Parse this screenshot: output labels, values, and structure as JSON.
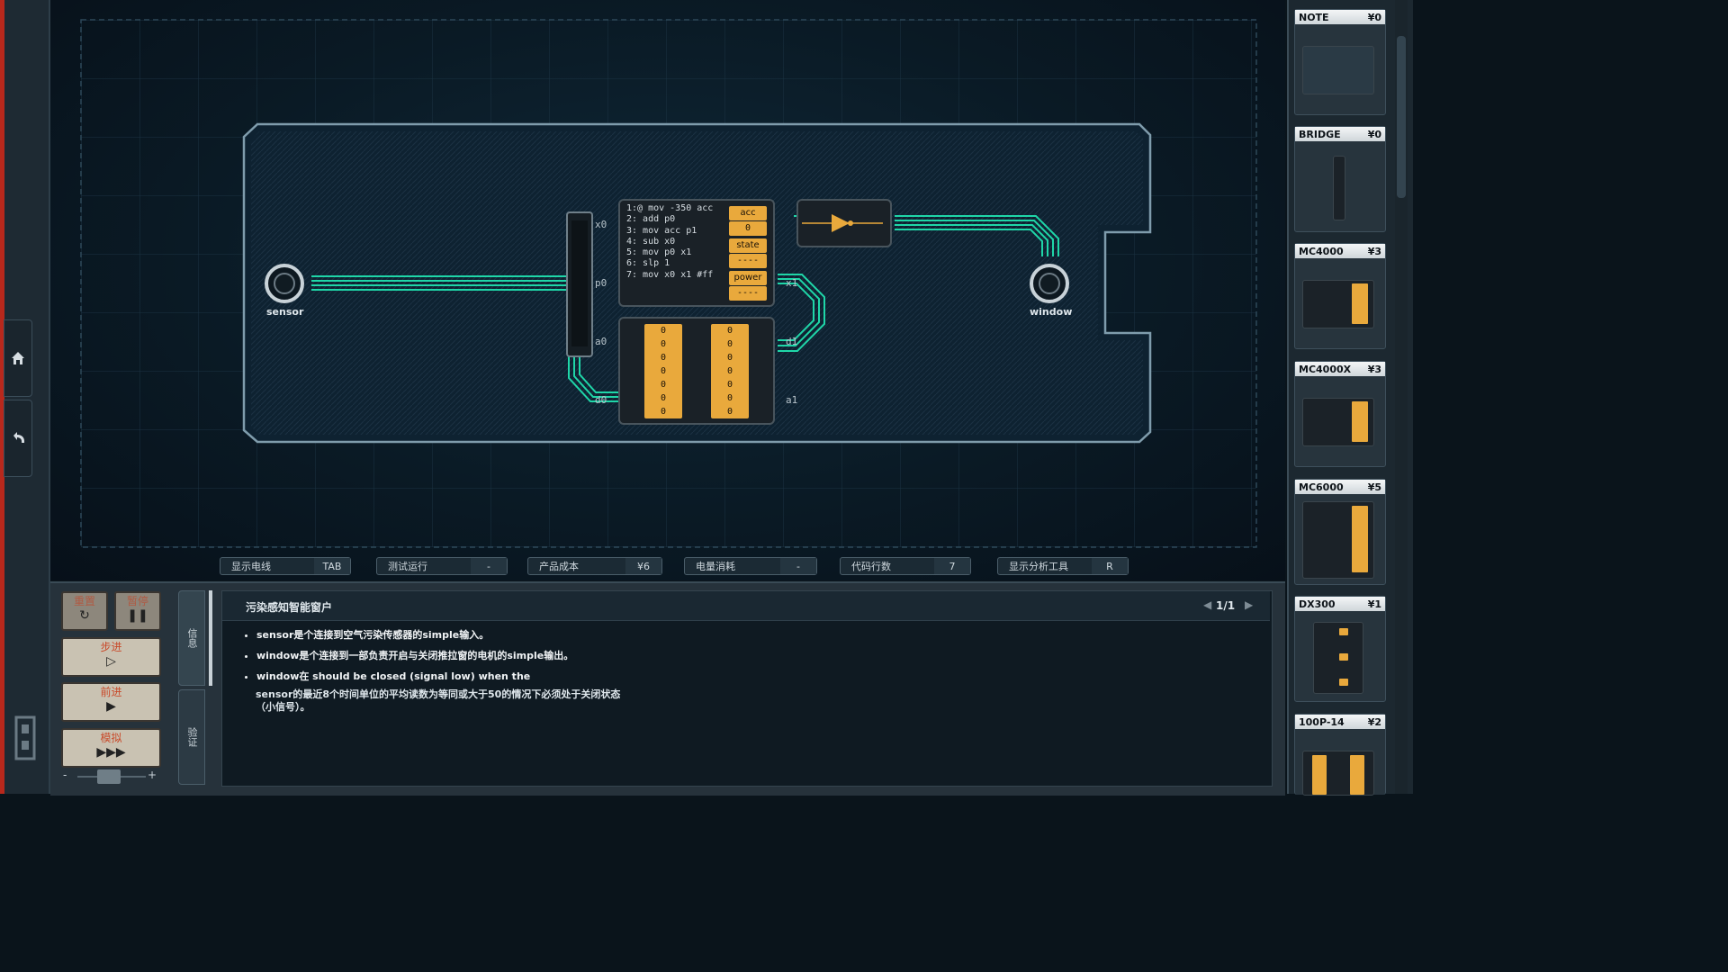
{
  "board": {
    "sensor_label": "sensor",
    "window_label": "window",
    "mc6000": {
      "code": [
        "1:@ mov -350 acc",
        "2:  add p0",
        "3:  mov acc p1",
        "4:  sub x0",
        "5:  mov p0 x1",
        "6:  slp 1",
        "7:  mov x0 x1 #ff"
      ],
      "registers": [
        {
          "name": "acc",
          "value": "0"
        },
        {
          "name": "state",
          "value": "----"
        },
        {
          "name": "power",
          "value": "----"
        }
      ],
      "ports": {
        "x0": "x0",
        "p0": "p0",
        "x1": "x1"
      }
    },
    "ram": {
      "col_a": [
        "0",
        "0",
        "0",
        "0",
        "0",
        "0",
        "0"
      ],
      "col_b": [
        "0",
        "0",
        "0",
        "0",
        "0",
        "0",
        "0"
      ],
      "ports": {
        "a0": "a0",
        "d0": "d0",
        "d1": "d1",
        "a1": "a1"
      }
    }
  },
  "status_bar": [
    {
      "label": "显示电线",
      "value": "TAB"
    },
    {
      "label": "测试运行",
      "value": "-"
    },
    {
      "label": "产品成本",
      "value": "¥6"
    },
    {
      "label": "电量消耗",
      "value": "-"
    },
    {
      "label": "代码行数",
      "value": "7"
    },
    {
      "label": "显示分析工具",
      "value": "R"
    }
  ],
  "controls": {
    "reset": "重置",
    "pause": "暂停",
    "step": "步进",
    "advance": "前进",
    "simulate": "模拟",
    "minus": "-",
    "plus": "+"
  },
  "tabs": {
    "info": "信息",
    "verify": "验证"
  },
  "task": {
    "title": "污染感知智能窗户",
    "page": "1/1",
    "bullets": [
      "sensor是个连接到空气污染传感器的simple输入。",
      "window是个连接到一部负责开启与关闭推拉窗的电机的simple输出。",
      "window在 should be closed (signal low) when the"
    ],
    "extra": "sensor的最近8个时间单位的平均读数为等同或大于50的情况下必须处于关闭状态（小信号）。"
  },
  "palette": [
    {
      "name": "NOTE",
      "price": "¥0"
    },
    {
      "name": "BRIDGE",
      "price": "¥0"
    },
    {
      "name": "MC4000",
      "price": "¥3"
    },
    {
      "name": "MC4000X",
      "price": "¥3"
    },
    {
      "name": "MC6000",
      "price": "¥5"
    },
    {
      "name": "DX300",
      "price": "¥1"
    },
    {
      "name": "100P-14",
      "price": "¥2"
    }
  ],
  "colors": {
    "wire": "#1fd6a8",
    "accent": "#e9a93c",
    "alert": "#b8281c"
  },
  "icons": {
    "home": "home-icon",
    "undo": "undo-icon",
    "logo": "logo-icon"
  }
}
